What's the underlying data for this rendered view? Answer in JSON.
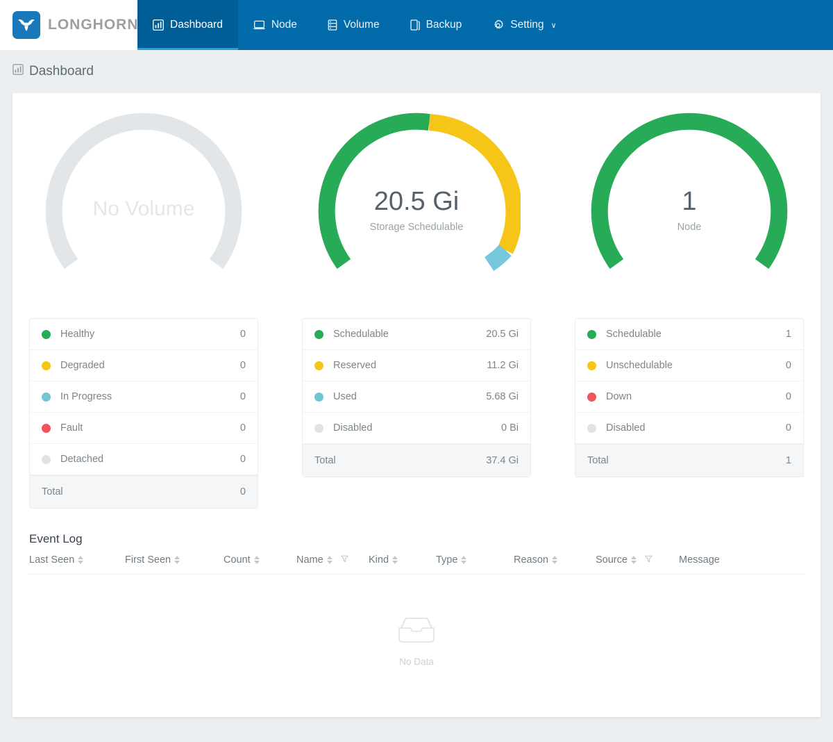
{
  "brand": {
    "name": "LONGHORN",
    "logo_icon": "longhorn-bull-icon"
  },
  "nav": {
    "items": [
      {
        "label": "Dashboard",
        "icon": "bar-chart-icon",
        "active": true
      },
      {
        "label": "Node",
        "icon": "monitor-icon",
        "active": false
      },
      {
        "label": "Volume",
        "icon": "database-icon",
        "active": false
      },
      {
        "label": "Backup",
        "icon": "copy-icon",
        "active": false
      },
      {
        "label": "Setting",
        "icon": "gear-icon",
        "active": false,
        "caret": "∨"
      }
    ]
  },
  "page": {
    "title": "Dashboard",
    "icon": "bar-chart-icon"
  },
  "colors": {
    "green": "#27ab56",
    "yellow": "#f5c518",
    "blue": "#77c8dc",
    "red": "#f0545c",
    "grey": "#dfe3e5",
    "nav_bg": "#046baa",
    "nav_active": "#015d96",
    "page_bg": "#eceff1"
  },
  "gauges": {
    "volume": {
      "value": "No Volume",
      "sublabel": "",
      "empty": true,
      "legend": [
        {
          "label": "Healthy",
          "value": "0",
          "color": "#27ab56"
        },
        {
          "label": "Degraded",
          "value": "0",
          "color": "#f5c518"
        },
        {
          "label": "In Progress",
          "value": "0",
          "color": "#72c5d4"
        },
        {
          "label": "Fault",
          "value": "0",
          "color": "#f0545c"
        },
        {
          "label": "Detached",
          "value": "0",
          "color": "#dfe3e5"
        }
      ],
      "total": {
        "label": "Total",
        "value": "0"
      }
    },
    "storage": {
      "value": "20.5 Gi",
      "sublabel": "Storage Schedulable",
      "empty": false,
      "legend": [
        {
          "label": "Schedulable",
          "value": "20.5 Gi",
          "color": "#27ab56"
        },
        {
          "label": "Reserved",
          "value": "11.2 Gi",
          "color": "#f5c518"
        },
        {
          "label": "Used",
          "value": "5.68 Gi",
          "color": "#72c5d4"
        },
        {
          "label": "Disabled",
          "value": "0 Bi",
          "color": "#dfe3e5"
        }
      ],
      "total": {
        "label": "Total",
        "value": "37.4 Gi"
      }
    },
    "node": {
      "value": "1",
      "sublabel": "Node",
      "empty": false,
      "legend": [
        {
          "label": "Schedulable",
          "value": "1",
          "color": "#27ab56"
        },
        {
          "label": "Unschedulable",
          "value": "0",
          "color": "#f5c518"
        },
        {
          "label": "Down",
          "value": "0",
          "color": "#f0545c"
        },
        {
          "label": "Disabled",
          "value": "0",
          "color": "#dfe3e5"
        }
      ],
      "total": {
        "label": "Total",
        "value": "1"
      }
    }
  },
  "chart_data": [
    {
      "type": "pie",
      "title": "No Volume",
      "labels": [
        "Healthy",
        "Degraded",
        "In Progress",
        "Fault",
        "Detached"
      ],
      "values": [
        0,
        0,
        0,
        0,
        0
      ],
      "colors": [
        "#27ab56",
        "#f5c518",
        "#72c5d4",
        "#f0545c",
        "#dfe3e5"
      ],
      "total": 0,
      "center_text": "No Volume",
      "empty": true,
      "legend": "below"
    },
    {
      "type": "pie",
      "title": "Storage Schedulable",
      "labels": [
        "Schedulable",
        "Reserved",
        "Used",
        "Disabled"
      ],
      "values": [
        20.5,
        11.2,
        5.68,
        0
      ],
      "unit": "Gi",
      "colors": [
        "#27ab56",
        "#f5c518",
        "#72c5d4",
        "#dfe3e5"
      ],
      "total": 37.4,
      "center_text": "20.5 Gi",
      "empty": false,
      "legend": "below"
    },
    {
      "type": "pie",
      "title": "Node",
      "labels": [
        "Schedulable",
        "Unschedulable",
        "Down",
        "Disabled"
      ],
      "values": [
        1,
        0,
        0,
        0
      ],
      "colors": [
        "#27ab56",
        "#f5c518",
        "#f0545c",
        "#dfe3e5"
      ],
      "total": 1,
      "center_text": "1",
      "empty": false,
      "legend": "below"
    }
  ],
  "event_log": {
    "title": "Event Log",
    "columns": [
      {
        "label": "Last Seen",
        "sortable": true,
        "filter": false
      },
      {
        "label": "First Seen",
        "sortable": true,
        "filter": false
      },
      {
        "label": "Count",
        "sortable": true,
        "filter": false
      },
      {
        "label": "Name",
        "sortable": true,
        "filter": true
      },
      {
        "label": "Kind",
        "sortable": true,
        "filter": false
      },
      {
        "label": "Type",
        "sortable": true,
        "filter": false
      },
      {
        "label": "Reason",
        "sortable": true,
        "filter": false
      },
      {
        "label": "Source",
        "sortable": true,
        "filter": true
      },
      {
        "label": "Message",
        "sortable": false,
        "filter": false
      }
    ],
    "rows": [],
    "empty_text": "No Data",
    "empty_icon": "inbox-icon"
  }
}
